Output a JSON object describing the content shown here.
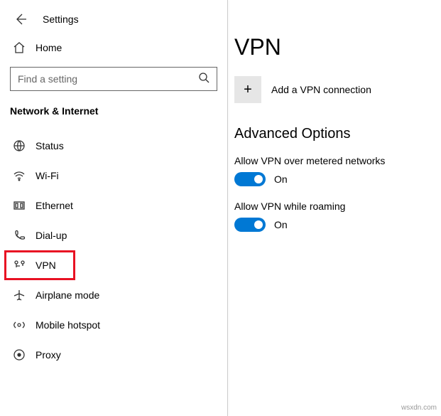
{
  "header": {
    "title": "Settings"
  },
  "home": {
    "label": "Home"
  },
  "search": {
    "placeholder": "Find a setting"
  },
  "section": {
    "title": "Network & Internet"
  },
  "nav": [
    {
      "label": "Status"
    },
    {
      "label": "Wi-Fi"
    },
    {
      "label": "Ethernet"
    },
    {
      "label": "Dial-up"
    },
    {
      "label": "VPN"
    },
    {
      "label": "Airplane mode"
    },
    {
      "label": "Mobile hotspot"
    },
    {
      "label": "Proxy"
    }
  ],
  "main": {
    "title": "VPN",
    "add": {
      "label": "Add a VPN connection",
      "plus": "+"
    },
    "advanced": {
      "header": "Advanced Options",
      "options": [
        {
          "label": "Allow VPN over metered networks",
          "state": "On"
        },
        {
          "label": "Allow VPN while roaming",
          "state": "On"
        }
      ]
    }
  },
  "watermark": "wsxdn.com"
}
